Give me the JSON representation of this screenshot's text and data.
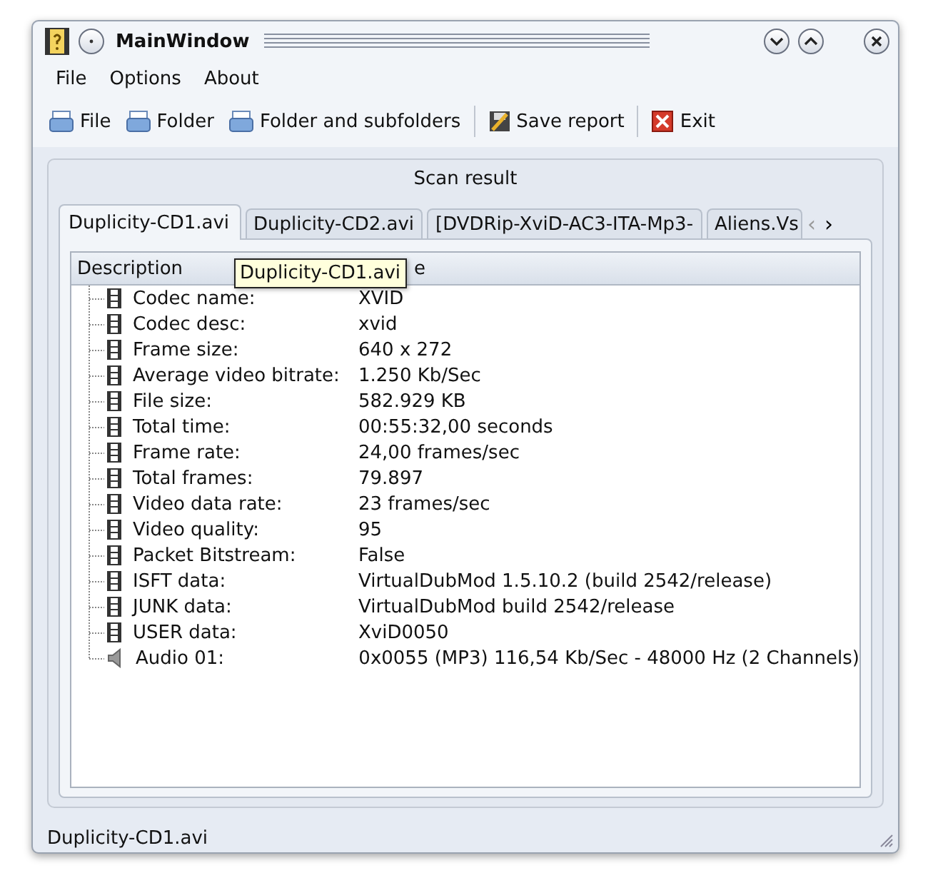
{
  "window": {
    "title": "MainWindow"
  },
  "menu": [
    "File",
    "Options",
    "About"
  ],
  "toolbar": [
    {
      "label": "File",
      "kind": "scan"
    },
    {
      "label": "Folder",
      "kind": "scan"
    },
    {
      "label": "Folder and subfolders",
      "kind": "scan"
    },
    {
      "label": "Save report",
      "kind": "save"
    },
    {
      "label": "Exit",
      "kind": "exit"
    }
  ],
  "group": {
    "title": "Scan result"
  },
  "tabs": [
    {
      "label": "Duplicity-CD1.avi",
      "selected": true
    },
    {
      "label": "Duplicity-CD2.avi",
      "selected": false
    },
    {
      "label": "[DVDRip-XviD-AC3-ITA-Mp3-",
      "selected": false
    },
    {
      "label": "Aliens.Vs",
      "selected": false
    }
  ],
  "tab_scroll": {
    "left": "‹",
    "right": "›"
  },
  "tree": {
    "columns": [
      "Description",
      "e"
    ],
    "rows": [
      {
        "kind": "video",
        "label": "Codec name:",
        "value": "XVID"
      },
      {
        "kind": "video",
        "label": "Codec desc:",
        "value": "xvid"
      },
      {
        "kind": "video",
        "label": "Frame size:",
        "value": "640 x 272"
      },
      {
        "kind": "video",
        "label": "Average video bitrate:",
        "value": "1.250 Kb/Sec"
      },
      {
        "kind": "video",
        "label": "File size:",
        "value": "582.929 KB"
      },
      {
        "kind": "video",
        "label": "Total time:",
        "value": "00:55:32,00 seconds"
      },
      {
        "kind": "video",
        "label": "Frame rate:",
        "value": "24,00 frames/sec"
      },
      {
        "kind": "video",
        "label": "Total frames:",
        "value": "79.897"
      },
      {
        "kind": "video",
        "label": "Video data rate:",
        "value": "23 frames/sec"
      },
      {
        "kind": "video",
        "label": "Video quality:",
        "value": "95"
      },
      {
        "kind": "video",
        "label": "Packet Bitstream:",
        "value": "False"
      },
      {
        "kind": "video",
        "label": "ISFT data:",
        "value": "VirtualDubMod 1.5.10.2 (build 2542/release)"
      },
      {
        "kind": "video",
        "label": "JUNK data:",
        "value": "VirtualDubMod build 2542/release"
      },
      {
        "kind": "video",
        "label": "USER data:",
        "value": "XviD0050"
      },
      {
        "kind": "audio",
        "label": "Audio 01:",
        "value": "0x0055 (MP3) 116,54 Kb/Sec - 48000 Hz (2 Channels)"
      }
    ]
  },
  "tooltip": "Duplicity-CD1.avi",
  "status_bar": "Duplicity-CD1.avi"
}
